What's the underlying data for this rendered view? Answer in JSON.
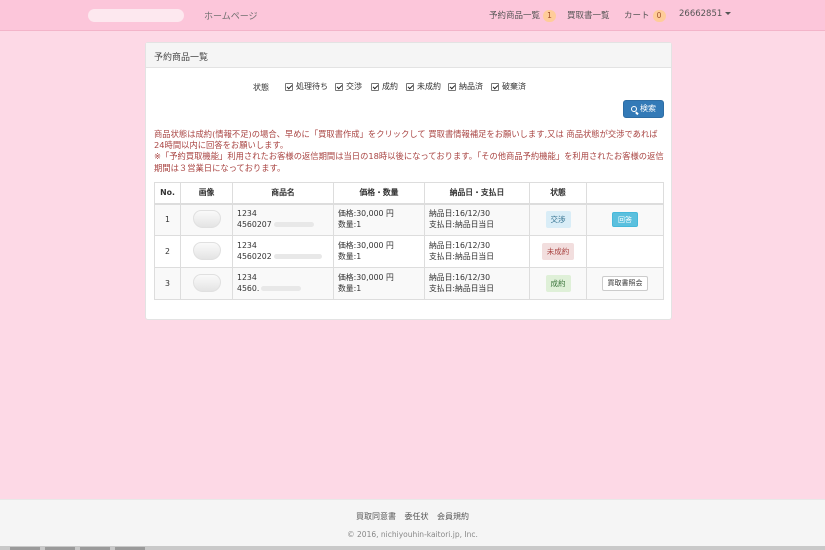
{
  "nav": {
    "home": "ホームページ",
    "reserved_items": "予約商品一覧",
    "reserved_count": "1",
    "purchase_docs": "買取書一覧",
    "cart": "カート",
    "cart_count": "0",
    "user_id": "26662851"
  },
  "panel": {
    "title": "予約商品一覧"
  },
  "filter": {
    "label": "状態",
    "options": [
      "処理待ち",
      "交渉",
      "成約",
      "未成約",
      "納品済",
      "破棄済"
    ],
    "search_button": "検索"
  },
  "notice": {
    "line1": "商品状態は成約(情報不足)の場合、早めに「買取書作成」をクリックして 買取書情報補足をお願いします,又は 商品状態が交渉であれば 24時間以内に回答をお願いします。",
    "line2": "※「予約買取機能」利用されたお客様の返信期間は当日の18時以後になっております。「その他商品予約機能」を利用されたお客様の返信期間は３営業日になっております。"
  },
  "table": {
    "headers": [
      "No.",
      "画像",
      "商品名",
      "価格・数量",
      "納品日・支払日",
      "状態",
      ""
    ],
    "rows": [
      {
        "no": "1",
        "name1": "1234",
        "name2": "4560207",
        "price": "価格:30,000 円",
        "qty": "数量:1",
        "delivery": "納品日:16/12/30",
        "payment": "支払日:納品日当日",
        "status": "交渉",
        "action": "回答"
      },
      {
        "no": "2",
        "name1": "1234",
        "name2": "4560202",
        "price": "価格:30,000 円",
        "qty": "数量:1",
        "delivery": "納品日:16/12/30",
        "payment": "支払日:納品日当日",
        "status": "未成約",
        "action": ""
      },
      {
        "no": "3",
        "name1": "1234",
        "name2": "4560.",
        "price": "価格:30,000 円",
        "qty": "数量:1",
        "delivery": "納品日:16/12/30",
        "payment": "支払日:納品日当日",
        "status": "成約",
        "action": "買取書照会"
      }
    ]
  },
  "footer": {
    "links": [
      "買取同意書",
      "委任状",
      "会員規約"
    ],
    "copyright": "© 2016, nichiyouhin-kaitori.jp, Inc."
  },
  "colors": {
    "page_bg": "#fdd9e6",
    "navbar_bg": "#fcc6da",
    "primary": "#337ab7",
    "info": "#5bc0de",
    "danger_text": "#a94442"
  }
}
